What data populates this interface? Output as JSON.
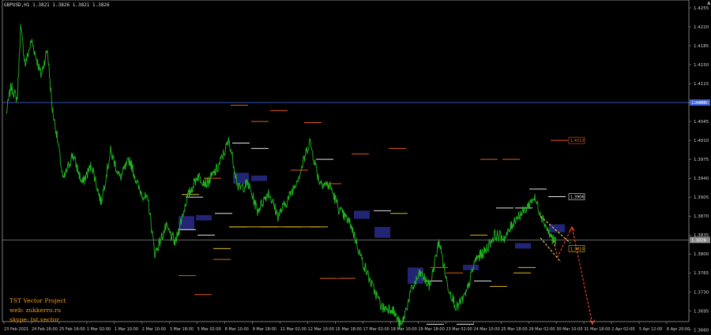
{
  "window": {
    "symbol_info": "GBPUSD,H1  1.3821 1.3826 1.3821 1.3826",
    "scroll_arrow": "▲"
  },
  "branding": {
    "project": "TST Vector Project",
    "web": "web: zukkerro.ru",
    "skype": "skype: tst.vector"
  },
  "price_axis": {
    "min": 1.3675,
    "max": 1.4255,
    "ticks": [
      "1.4255",
      "1.4220",
      "1.4185",
      "1.4150",
      "1.4115",
      "1.4080",
      "1.4045",
      "1.4010",
      "1.3975",
      "1.3940",
      "1.3905",
      "1.3870",
      "1.3835",
      "1.3800",
      "1.3765",
      "1.3730",
      "1.3695",
      "1.3660"
    ]
  },
  "time_axis": {
    "labels": [
      "23 Feb 2021",
      "24 Feb 16:00",
      "25 Feb 16:00",
      "1 Mar 02:00",
      "1 Mar 10:00",
      "2 Mar 10:00",
      "3 Mar 18:00",
      "5 Mar 02:00",
      "8 Mar 10:00",
      "9 Mar 18:00",
      "11 Mar 02:00",
      "12 Mar 10:00",
      "15 Mar 18:00",
      "17 Mar 02:00",
      "18 Mar 10:00",
      "19 Mar 18:00",
      "23 Mar 02:00",
      "24 Mar 10:00",
      "25 Mar 18:00",
      "29 Mar 02:00",
      "30 Mar 10:00",
      "31 Mar 18:00",
      "2 Apr 02:00",
      "5 Apr 12:00",
      "6 Apr 20:00"
    ]
  },
  "horizontal_lines": [
    {
      "price": 1.408,
      "color": "#3a5fd6",
      "label": "1.4080"
    },
    {
      "price": 1.3826,
      "color": "#8a8a8a",
      "label": "1.3826"
    }
  ],
  "price_labels": [
    {
      "price": 1.401,
      "text": "1.4010",
      "color": "#e05a1a"
    },
    {
      "price": 1.3906,
      "text": "1.3906",
      "color": "#e6e6e6"
    },
    {
      "price": 1.381,
      "text": "1.3810",
      "color": "#e0b81a"
    }
  ],
  "colors": {
    "candles": "#1fb81f",
    "level_white": "#e6e6e6",
    "level_orange": "#e05a1a",
    "level_yellow": "#e0b81a",
    "zone": "#2a2a8a",
    "forecast": "#ff4a2a",
    "channel": "#ffe84a"
  }
}
